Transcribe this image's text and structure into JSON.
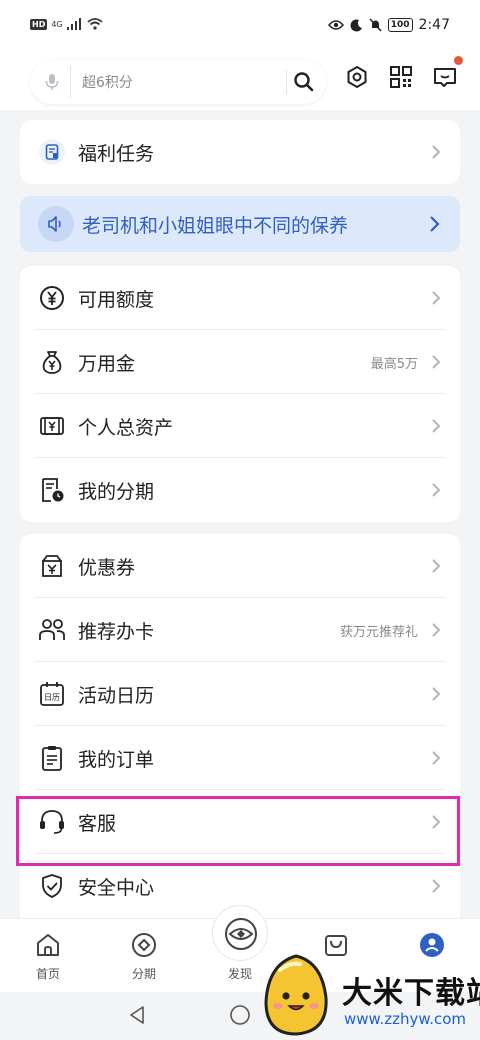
{
  "status_bar": {
    "hd": "HD",
    "network": "4G",
    "battery": "100",
    "time": "2:47"
  },
  "search": {
    "placeholder": "超6积分"
  },
  "top_icons": [
    "settings-hex-icon",
    "qr-scan-icon",
    "message-icon"
  ],
  "welfare": {
    "label": "福利任务"
  },
  "banner": {
    "text": "老司机和小姐姐眼中不同的保养"
  },
  "finance_items": [
    {
      "label": "可用额度",
      "hint": ""
    },
    {
      "label": "万用金",
      "hint": "最高5万"
    },
    {
      "label": "个人总资产",
      "hint": ""
    },
    {
      "label": "我的分期",
      "hint": ""
    }
  ],
  "service_items": [
    {
      "label": "优惠券",
      "hint": ""
    },
    {
      "label": "推荐办卡",
      "hint": "获万元推荐礼"
    },
    {
      "label": "活动日历",
      "hint": ""
    },
    {
      "label": "我的订单",
      "hint": ""
    },
    {
      "label": "客服",
      "hint": ""
    },
    {
      "label": "安全中心",
      "hint": ""
    }
  ],
  "tabs": [
    {
      "label": "首页"
    },
    {
      "label": "分期"
    },
    {
      "label": "发现"
    },
    {
      "label": ""
    },
    {
      "label": ""
    }
  ],
  "watermark": {
    "title": "大米下载站",
    "url": "www.zzhyw.com"
  },
  "colors": {
    "accent": "#2f61c2",
    "highlight": "#e02ab2",
    "banner_bg": "#dde8fb",
    "badge": "#e8553a"
  }
}
